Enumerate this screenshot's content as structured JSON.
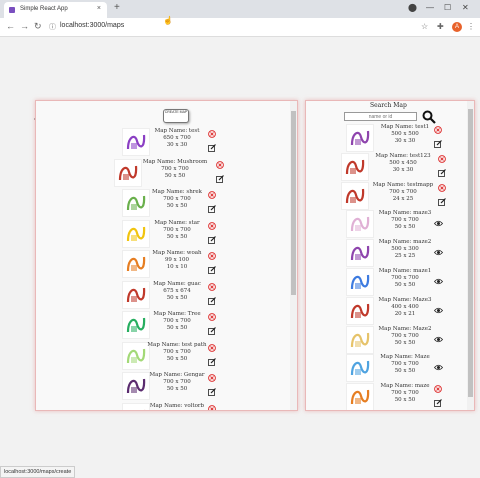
{
  "browser": {
    "tab_title": "Simple React App",
    "tab_close": "×",
    "new_tab": "+",
    "url": "localhost:3000/maps",
    "profile_initial": "A",
    "minimize": "—",
    "maximize": "☐",
    "close": "✕"
  },
  "left_panel": {
    "create_button": "CREATE MAP",
    "items": [
      {
        "name": "Map Name: test",
        "size": "650 x 700",
        "grid": "30 x 30",
        "thumb_color": "#8b3fc4"
      },
      {
        "name": "Map Name: Mushroom",
        "size": "700 x 700",
        "grid": "50 x 50",
        "thumb_color": "#c0392b"
      },
      {
        "name": "Map Name: shrek",
        "size": "700 x 700",
        "grid": "50 x 50",
        "thumb_color": "#6ab04c"
      },
      {
        "name": "Map Name: star",
        "size": "700 x 700",
        "grid": "50 x 50",
        "thumb_color": "#f1c40f"
      },
      {
        "name": "Map Name: woah",
        "size": "99 x 100",
        "grid": "10 x 10",
        "thumb_color": "#e67e22"
      },
      {
        "name": "Map Name: guac",
        "size": "675 x 674",
        "grid": "50 x 50",
        "thumb_color": "#c0392b"
      },
      {
        "name": "Map Name: Tree",
        "size": "700 x 700",
        "grid": "50 x 50",
        "thumb_color": "#27ae60"
      },
      {
        "name": "Map Name: test path",
        "size": "700 x 700",
        "grid": "50 x 50",
        "thumb_color": "#a3d977"
      },
      {
        "name": "Map Name: Gengar",
        "size": "700 x 700",
        "grid": "50 x 50",
        "thumb_color": "#5b2c6f"
      },
      {
        "name": "Map Name: voltorb",
        "size": "700 x 700",
        "grid": "",
        "thumb_color": "#c0392b"
      }
    ]
  },
  "right_panel": {
    "title": "Search Map",
    "search_placeholder": "name or id",
    "items": [
      {
        "name": "Map Name: test1",
        "size": "500 x 500",
        "grid": "30 x 30",
        "action": "edit",
        "thumb_color": "#8e44ad"
      },
      {
        "name": "Map Name: test123",
        "size": "500 x 450",
        "grid": "30 x 30",
        "action": "edit",
        "thumb_color": "#c0392b"
      },
      {
        "name": "Map Name: testmapp",
        "size": "700 x 700",
        "grid": "24 x 25",
        "action": "edit",
        "thumb_color": "#c0392b"
      },
      {
        "name": "Map Name: maze3",
        "size": "700 x 700",
        "grid": "50 x 50",
        "action": "view",
        "thumb_color": "#e0b0d5"
      },
      {
        "name": "Map Name: maze2",
        "size": "500 x 300",
        "grid": "25 x 25",
        "action": "view",
        "thumb_color": "#8e44ad"
      },
      {
        "name": "Map Name: maze1",
        "size": "700 x 700",
        "grid": "50 x 50",
        "action": "view",
        "thumb_color": "#3d7be0"
      },
      {
        "name": "Map Name: Maze3",
        "size": "400 x 400",
        "grid": "20 x 21",
        "action": "view",
        "thumb_color": "#c0392b"
      },
      {
        "name": "Map Name: Maze2",
        "size": "700 x 700",
        "grid": "50 x 50",
        "action": "view",
        "thumb_color": "#e6c36a"
      },
      {
        "name": "Map Name: Maze",
        "size": "700 x 700",
        "grid": "50 x 50",
        "action": "view",
        "thumb_color": "#4fa3e0"
      },
      {
        "name": "Map Name: maze",
        "size": "700 x 700",
        "grid": "50 x 50",
        "action": "edit",
        "thumb_color": "#e67e22"
      }
    ]
  },
  "status_bar": "localhost:3000/maps/create"
}
